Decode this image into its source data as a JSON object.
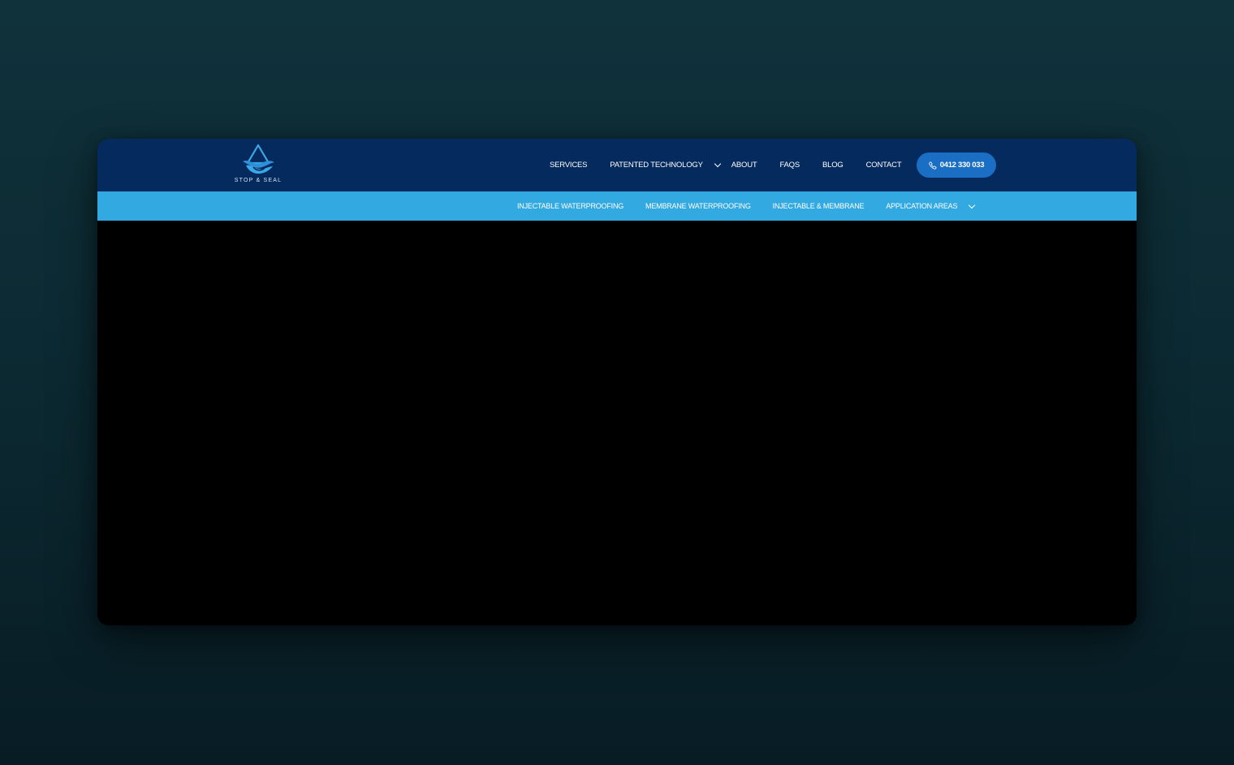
{
  "brand": {
    "logo_text": "STOP & SEAL",
    "logo_icon": "water-drop-wave-icon"
  },
  "main_nav": {
    "items": [
      {
        "label": "SERVICES"
      },
      {
        "label": "PATENTED TECHNOLOGY",
        "has_dropdown": true
      },
      {
        "label": "ABOUT"
      },
      {
        "label": "FAQS"
      },
      {
        "label": "BLOG"
      },
      {
        "label": "CONTACT"
      }
    ],
    "phone_button": {
      "label": "0412 330 033",
      "icon": "phone-icon"
    }
  },
  "sub_nav": {
    "items": [
      {
        "label": "INJECTABLE WATERPROOFING"
      },
      {
        "label": "MEMBRANE WATERPROOFING"
      },
      {
        "label": "INJECTABLE & MEMBRANE"
      },
      {
        "label": "APPLICATION AREAS",
        "has_dropdown": true
      }
    ]
  },
  "colors": {
    "page_background": "#0d2c35",
    "topbar": "#052a5e",
    "subbar": "#33a9e1",
    "phone_button": "#1a6ec4",
    "hero": "#000000"
  }
}
